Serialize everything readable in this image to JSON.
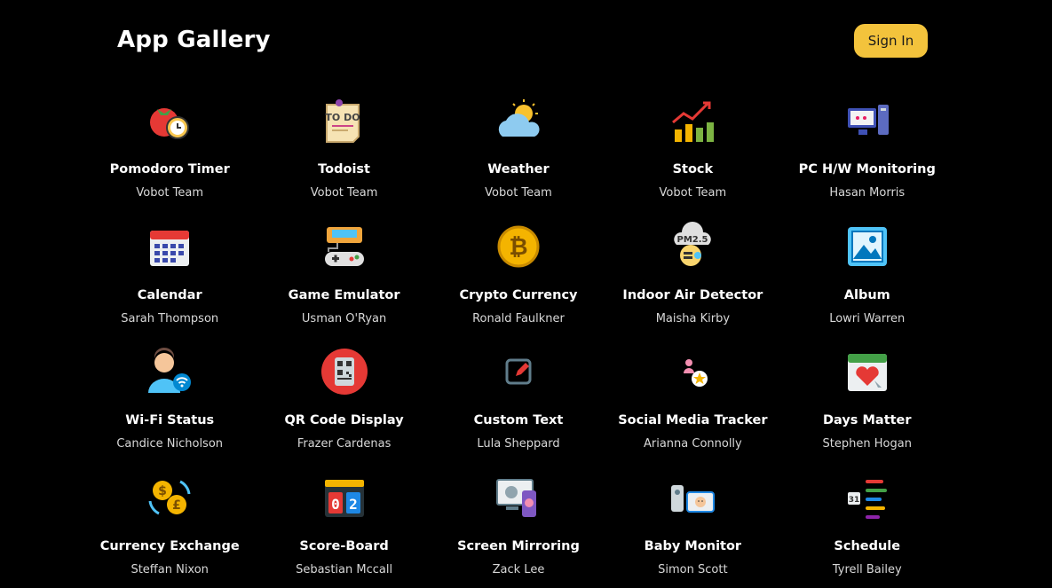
{
  "header": {
    "title": "App Gallery",
    "sign_in_label": "Sign In"
  },
  "colors": {
    "background": "#000000",
    "accent": "#f3c33c"
  },
  "apps": [
    {
      "name": "Pomodoro Timer",
      "author": "Vobot Team",
      "icon": "tomato-clock-icon"
    },
    {
      "name": "Todoist",
      "author": "Vobot Team",
      "icon": "todo-note-icon"
    },
    {
      "name": "Weather",
      "author": "Vobot Team",
      "icon": "sun-cloud-icon"
    },
    {
      "name": "Stock",
      "author": "Vobot Team",
      "icon": "stock-chart-icon"
    },
    {
      "name": "PC H/W Monitoring",
      "author": "Hasan Morris",
      "icon": "pc-monitor-icon"
    },
    {
      "name": "Calendar",
      "author": "Sarah Thompson",
      "icon": "calendar-icon"
    },
    {
      "name": "Game Emulator",
      "author": "Usman O'Ryan",
      "icon": "game-console-icon"
    },
    {
      "name": "Crypto Currency",
      "author": "Ronald Faulkner",
      "icon": "bitcoin-icon"
    },
    {
      "name": "Indoor Air Detector",
      "author": "Maisha Kirby",
      "icon": "pm25-cloud-icon"
    },
    {
      "name": "Album",
      "author": "Lowri Warren",
      "icon": "photo-album-icon"
    },
    {
      "name": "Wi-Fi Status",
      "author": "Candice Nicholson",
      "icon": "person-wifi-icon"
    },
    {
      "name": "QR Code Display",
      "author": "Frazer Cardenas",
      "icon": "qr-code-icon"
    },
    {
      "name": "Custom Text",
      "author": "Lula Sheppard",
      "icon": "edit-square-icon"
    },
    {
      "name": "Social Media Tracker",
      "author": "Arianna Connolly",
      "icon": "social-star-icon"
    },
    {
      "name": "Days Matter",
      "author": "Stephen Hogan",
      "icon": "heart-calendar-icon"
    },
    {
      "name": "Currency Exchange",
      "author": "Steffan Nixon",
      "icon": "currency-exchange-icon"
    },
    {
      "name": "Score-Board",
      "author": "Sebastian Mccall",
      "icon": "scoreboard-icon"
    },
    {
      "name": "Screen Mirroring",
      "author": "Zack Lee",
      "icon": "screen-mirror-icon"
    },
    {
      "name": "Baby Monitor",
      "author": "Simon Scott",
      "icon": "baby-monitor-icon"
    },
    {
      "name": "Schedule",
      "author": "Tyrell Bailey",
      "icon": "schedule-list-icon"
    }
  ]
}
